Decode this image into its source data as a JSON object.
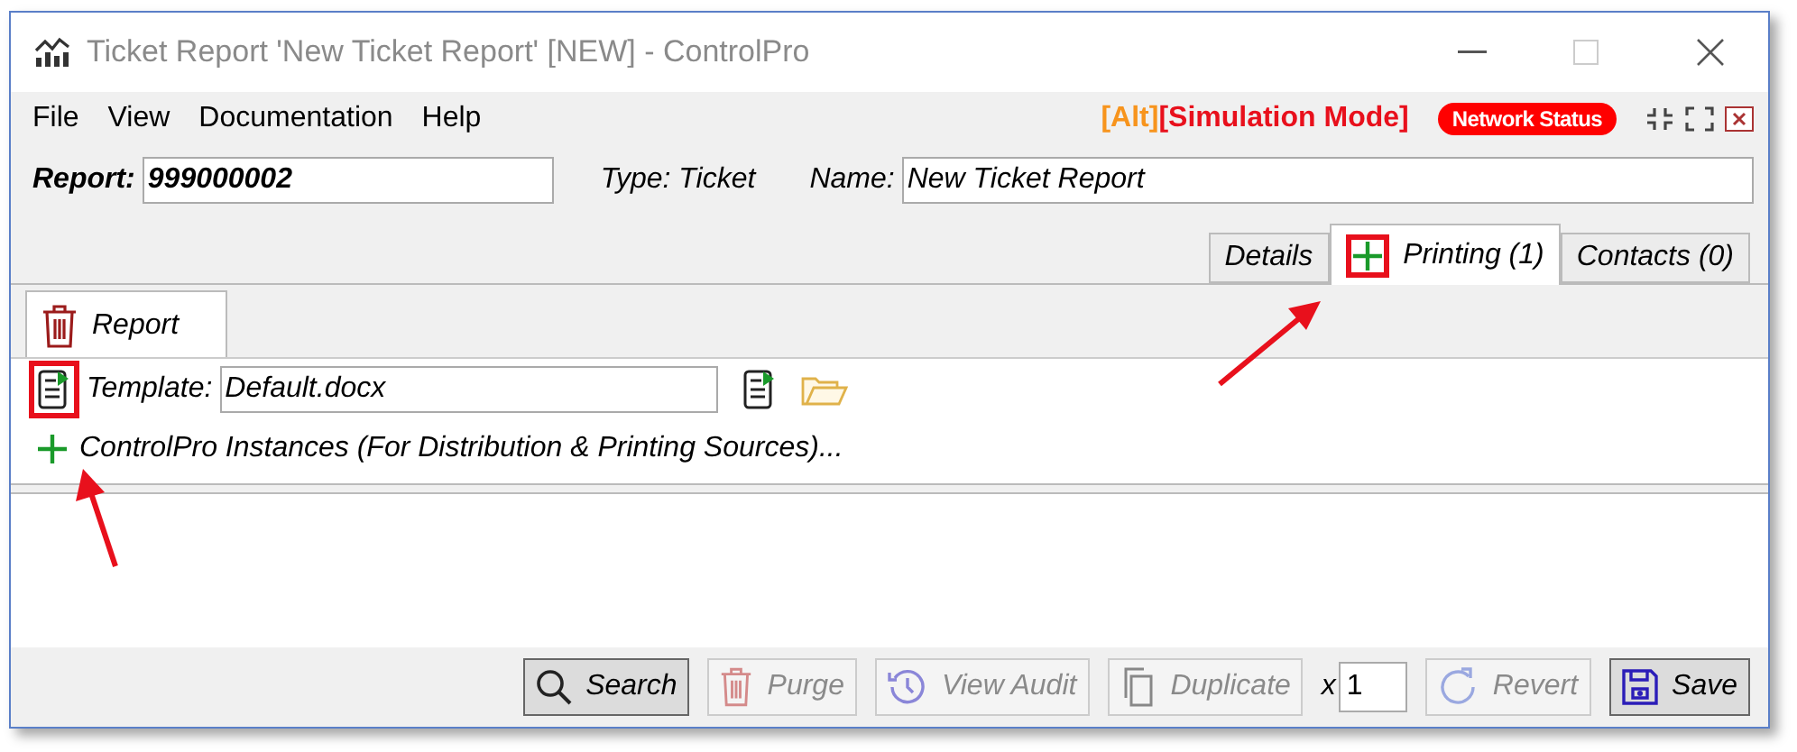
{
  "window": {
    "title": "Ticket Report 'New Ticket Report' [NEW] - ControlPro"
  },
  "menu": [
    {
      "label": "File"
    },
    {
      "label": "View"
    },
    {
      "label": "Documentation"
    },
    {
      "label": "Help"
    }
  ],
  "status": {
    "alt": "[Alt]",
    "mode": "[Simulation Mode]",
    "network": "Network Status"
  },
  "header": {
    "report_label": "Report:",
    "report_value": "999000002",
    "type": "Type: Ticket",
    "name_label": "Name:",
    "name_value": "New Ticket Report"
  },
  "tabs": [
    {
      "label": "Details",
      "selected": false,
      "add_icon": false
    },
    {
      "label": "Printing (1)",
      "selected": true,
      "add_icon": true
    },
    {
      "label": "Contacts (0)",
      "selected": false,
      "add_icon": false
    }
  ],
  "subtabs": [
    {
      "label": "Report",
      "selected": true
    }
  ],
  "template": {
    "label": "Template:",
    "value": "Default.docx"
  },
  "instances": {
    "label": "ControlPro Instances (For Distribution & Printing Sources)..."
  },
  "toolbar": [
    {
      "kind": "search",
      "label": "Search",
      "disabled": false
    },
    {
      "kind": "trash",
      "label": "Purge",
      "disabled": true
    },
    {
      "kind": "history",
      "label": "View Audit",
      "disabled": true
    },
    {
      "kind": "copy",
      "label": "Duplicate",
      "disabled": true
    },
    {
      "kind": "copies",
      "label": "x",
      "value": "1"
    },
    {
      "kind": "revert",
      "label": "Revert",
      "disabled": true
    },
    {
      "kind": "save",
      "label": "Save",
      "disabled": false
    }
  ]
}
